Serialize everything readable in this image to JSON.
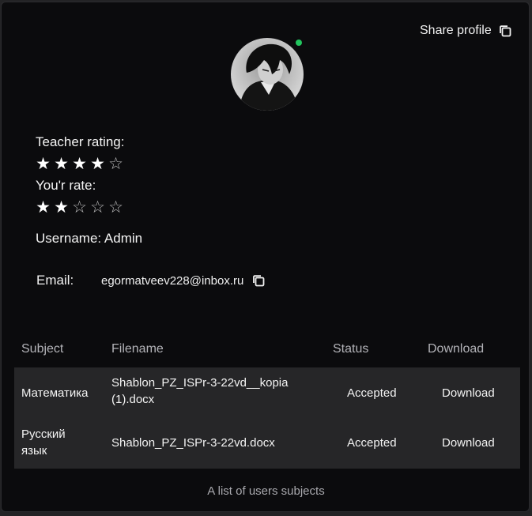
{
  "profile": {
    "share_label": "Share profile",
    "share_icon": "copy-icon",
    "avatar_alt": "user avatar",
    "online_color": "#22c55e"
  },
  "ratings": {
    "teacher_label": "Teacher rating:",
    "teacher_stars": 4,
    "your_label": "You'r rate:",
    "your_stars": 2,
    "max_stars": 5,
    "filled_glyph": "★",
    "empty_glyph": "☆"
  },
  "user": {
    "username_text": "Username: Admin",
    "email_label": "Email:",
    "email_value": "egormatveev228@inbox.ru"
  },
  "table": {
    "columns": [
      "Subject",
      "Filename",
      "Status",
      "Download"
    ],
    "rows": [
      {
        "subject": "Математика",
        "filename": "Shablon_PZ_ISPr-3-22vd__kopia (1).docx",
        "status": "Accepted",
        "download": "Download"
      },
      {
        "subject": "Русский язык",
        "filename": "Shablon_PZ_ISPr-3-22vd.docx",
        "status": "Accepted",
        "download": "Download"
      }
    ],
    "caption": "A list of users subjects"
  }
}
